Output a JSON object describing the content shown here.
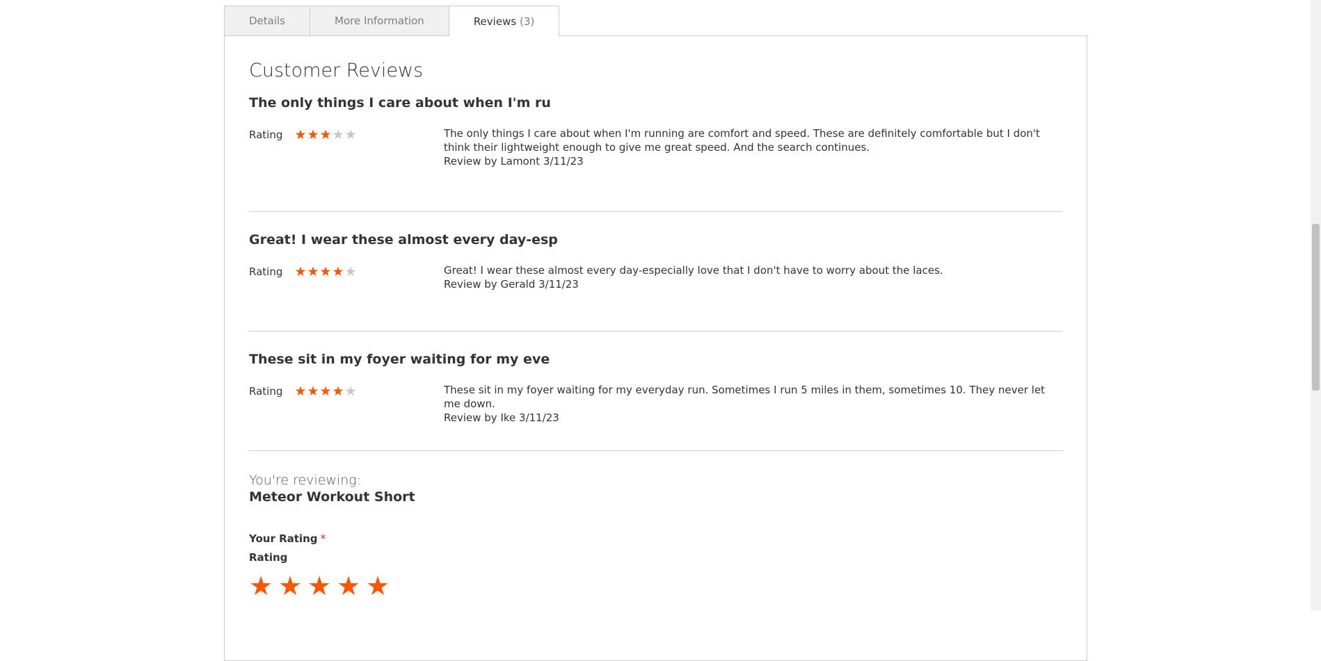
{
  "tabs": [
    {
      "label": "Details"
    },
    {
      "label": "More Information"
    },
    {
      "label": "Reviews",
      "count": "(3)"
    }
  ],
  "section_title": "Customer Reviews",
  "rating_label": "Rating",
  "reviews": [
    {
      "title": "The only things I care about when I'm ru",
      "stars": 3,
      "text": "The only things I care about when I'm running are comfort and speed. These are definitely comfortable but I don't think their lightweight enough to give me great speed. And the search continues.",
      "byline": "Review by Lamont 3/11/23"
    },
    {
      "title": "Great! I wear these almost every day-esp",
      "stars": 4,
      "text": "Great! I wear these almost every day-especially love that I don't have to worry about the laces.",
      "byline": "Review by Gerald 3/11/23"
    },
    {
      "title": "These sit in my foyer waiting for my eve",
      "stars": 4,
      "text": "These sit in my foyer waiting for my everyday run. Sometimes I run 5 miles in them, sometimes 10. They never let me down.",
      "byline": "Review by Ike 3/11/23"
    }
  ],
  "form": {
    "youre_reviewing": "You're reviewing:",
    "product": "Meteor Workout Short",
    "your_rating": "Your Rating",
    "required_mark": "*",
    "rating_sub": "Rating"
  },
  "colors": {
    "star_on": "#ff5501",
    "star_off": "#c7c7c7",
    "required": "#e02b27"
  },
  "icons": {
    "star": "★"
  }
}
